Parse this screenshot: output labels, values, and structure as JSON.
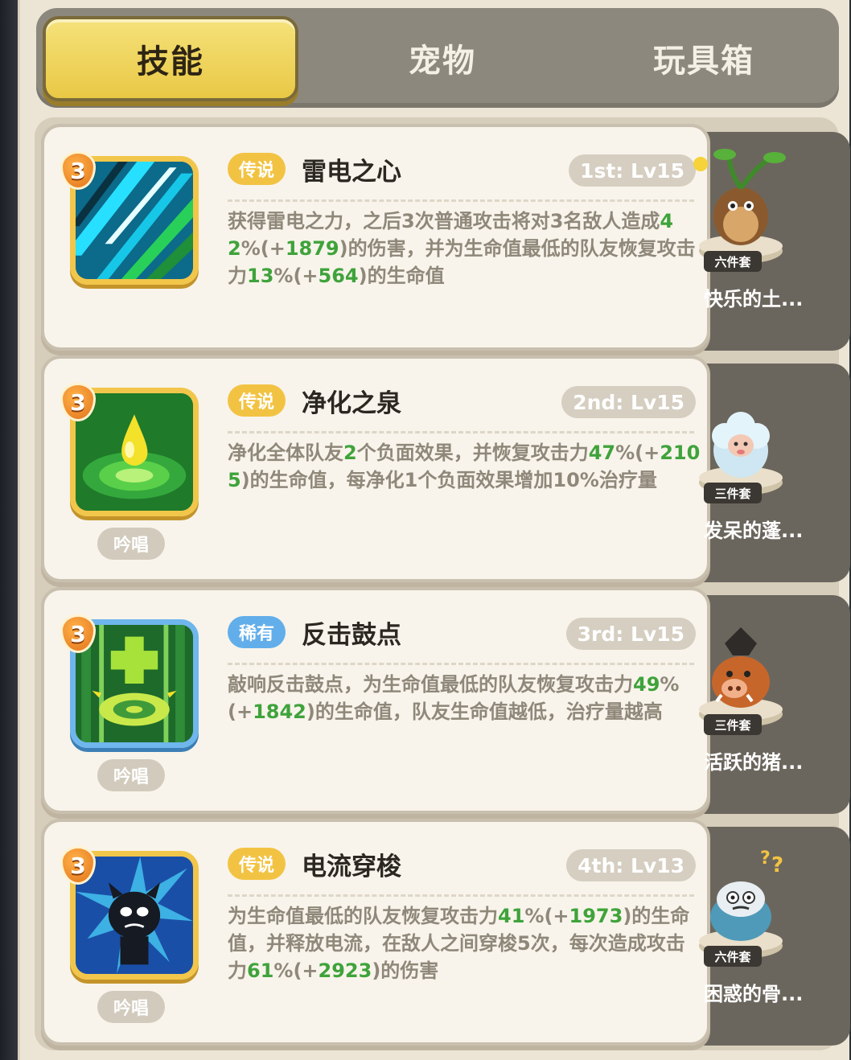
{
  "tabs": [
    {
      "label": "技能",
      "active": true
    },
    {
      "label": "宠物",
      "active": false
    },
    {
      "label": "玩具箱",
      "active": false
    }
  ],
  "skills": [
    {
      "level": "3",
      "rarity": "传说",
      "name": "雷电之心",
      "rank": "1st: Lv15",
      "chant": "",
      "desc": [
        "获得雷电之力，之后3次普通攻击将对3名敌人造成",
        "42",
        "%(+",
        "1879",
        ")的伤害，并为生命值最低的队友恢复攻击力",
        "13",
        "%(+",
        "564",
        ")的生命值"
      ],
      "pet": {
        "set": "六件套",
        "name": "快乐的土..."
      }
    },
    {
      "level": "3",
      "rarity": "传说",
      "name": "净化之泉",
      "rank": "2nd: Lv15",
      "chant": "吟唱",
      "desc": [
        "净化全体队友",
        "2",
        "个负面效果，并恢复攻击力",
        "47",
        "%(+",
        "2105",
        ")的生命值，每净化1个负面效果增加10%治疗量",
        "",
        "",
        "",
        ""
      ],
      "pet": {
        "set": "三件套",
        "name": "发呆的蓬..."
      }
    },
    {
      "level": "3",
      "rarity": "稀有",
      "name": "反击鼓点",
      "rank": "3rd: Lv15",
      "chant": "吟唱",
      "desc": [
        "敲响反击鼓点，为生命值最低的队友恢复攻击力",
        "49",
        "%(+",
        "1842",
        ")的生命值，队友生命值越低，治疗量越高",
        "",
        "",
        "",
        ""
      ],
      "pet": {
        "set": "三件套",
        "name": "活跃的猪..."
      }
    },
    {
      "level": "3",
      "rarity": "传说",
      "name": "电流穿梭",
      "rank": "4th: Lv13",
      "chant": "吟唱",
      "desc": [
        "为生命值最低的队友恢复攻击力",
        "41",
        "%(+",
        "1973",
        ")的生命值，并释放电流，在敌人之间穿梭5次，每次造成攻击力",
        "61",
        "%(+",
        "2923",
        ")的伤害"
      ],
      "pet": {
        "set": "六件套",
        "name": "困惑的骨..."
      }
    }
  ],
  "colors": {
    "legend": "#f2c343",
    "rare": "#62aeea",
    "highlight": "#3fa33b"
  },
  "icons": [
    "lightning-skill-icon",
    "spring-drop-skill-icon",
    "drum-heal-skill-icon",
    "electric-shadow-skill-icon"
  ]
}
